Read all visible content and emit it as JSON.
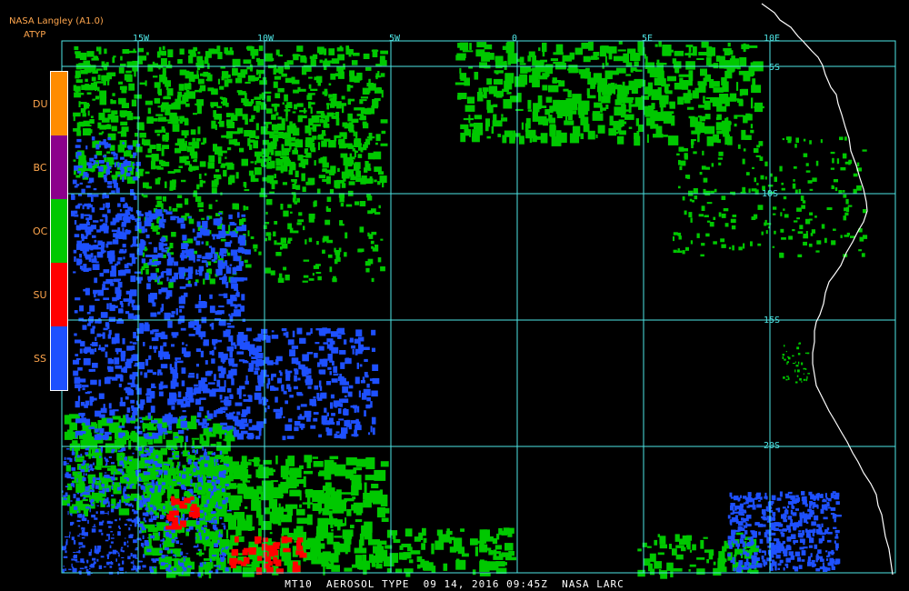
{
  "header": {
    "source": "NASA Langley (A1.0)",
    "product": "ATYP"
  },
  "legend": {
    "items": [
      {
        "label": "DU",
        "color": "#ff8c00"
      },
      {
        "label": "BC",
        "color": "#8b008b"
      },
      {
        "label": "OC",
        "color": "#00c800"
      },
      {
        "label": "SU",
        "color": "#ff0000"
      },
      {
        "label": "SS",
        "color": "#1e50ff"
      }
    ]
  },
  "grid": {
    "lon_labels": [
      "15W",
      "10W",
      "5W",
      "0",
      "5E",
      "10E"
    ],
    "lat_labels": [
      "5S",
      "10S",
      "15S",
      "20S"
    ],
    "line_color": "#4ee6e6"
  },
  "coast_color": "#ffffff",
  "footer": {
    "text": "MT10  AEROSOL TYPE  09 14, 2016 09:45Z  NASA LARC"
  }
}
